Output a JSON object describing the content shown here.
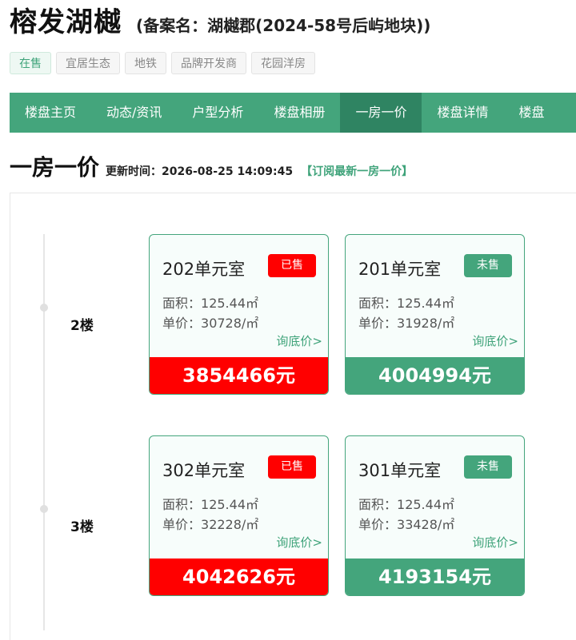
{
  "header": {
    "title": "榕发湖樾",
    "alias": "(备案名：湖樾郡(2024-58号后屿地块))"
  },
  "tags": [
    "在售",
    "宜居生态",
    "地铁",
    "品牌开发商",
    "花园洋房"
  ],
  "nav": {
    "items": [
      "楼盘主页",
      "动态/资讯",
      "户型分析",
      "楼盘相册",
      "一房一价",
      "楼盘详情",
      "楼盘"
    ],
    "active_index": 4
  },
  "section": {
    "title": "一房一价",
    "update_label": "更新时间：",
    "update_time": "2026-08-25 14:09:45",
    "subscribe": "【订阅最新一房一价】"
  },
  "area_label": "面积：",
  "unit_price_label": "单价：",
  "ask_price": "询底价>",
  "floors": [
    {
      "label": "2楼",
      "units": [
        {
          "room": "202单元室",
          "status": "已售",
          "sold": true,
          "area": "125.44㎡",
          "unit_price": "30728/㎡",
          "total": "3854466元"
        },
        {
          "room": "201单元室",
          "status": "未售",
          "sold": false,
          "area": "125.44㎡",
          "unit_price": "31928/㎡",
          "total": "4004994元"
        }
      ]
    },
    {
      "label": "3楼",
      "units": [
        {
          "room": "302单元室",
          "status": "已售",
          "sold": true,
          "area": "125.44㎡",
          "unit_price": "32228/㎡",
          "total": "4042626元"
        },
        {
          "room": "301单元室",
          "status": "未售",
          "sold": false,
          "area": "125.44㎡",
          "unit_price": "33428/㎡",
          "total": "4193154元"
        }
      ]
    }
  ],
  "colors": {
    "brand_green": "#44a57c",
    "active_green": "#2f8462",
    "sold_red": "#ff0000"
  }
}
